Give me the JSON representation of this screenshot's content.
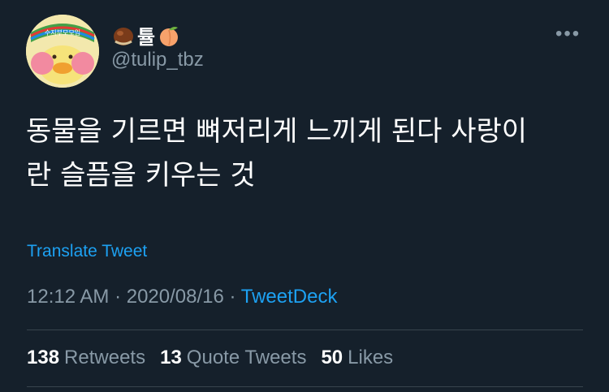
{
  "user": {
    "display_name": "튤",
    "handle": "@tulip_tbz",
    "avatar_band_text": "수지부모모임"
  },
  "tweet": {
    "text_line1": "동물을 기르면 뼈저리게 느끼게 된다 사랑이",
    "text_line2": "란 슬픔을 키우는 것"
  },
  "translate_label": "Translate Tweet",
  "meta": {
    "time": "12:12 AM",
    "sep1": " · ",
    "date": "2020/08/16",
    "sep2": " · ",
    "source": "TweetDeck"
  },
  "stats": {
    "retweets_count": "138",
    "retweets_label": "Retweets",
    "quotes_count": "13",
    "quotes_label": "Quote Tweets",
    "likes_count": "50",
    "likes_label": "Likes"
  },
  "more_glyph": "•••",
  "colors": {
    "background": "#15202b",
    "accent": "#1da1f2",
    "secondary_text": "#8899a6",
    "divider": "#38444d"
  },
  "icons": [
    "chestnut-emoji-icon",
    "peach-emoji-icon",
    "more-options-icon"
  ]
}
